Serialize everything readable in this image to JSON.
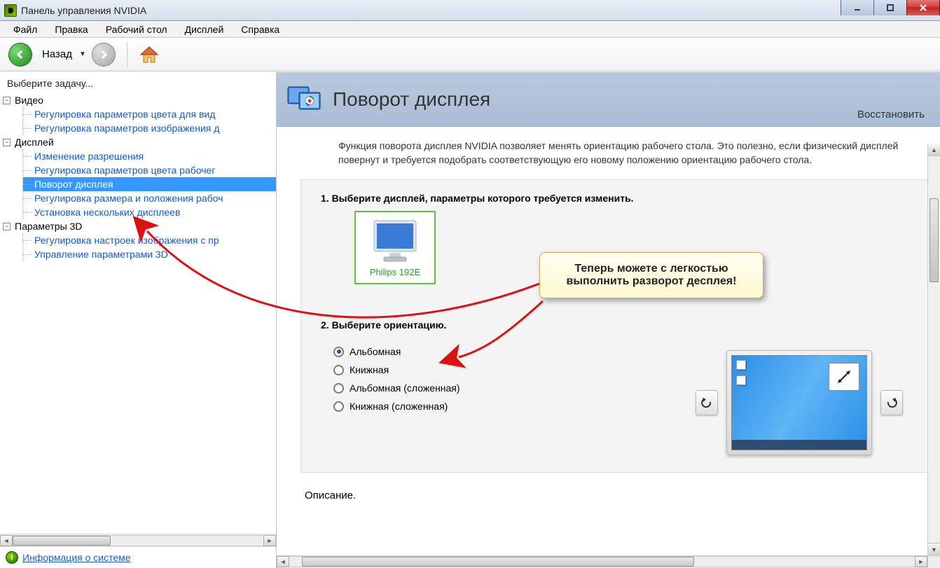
{
  "window": {
    "title": "Панель управления NVIDIA"
  },
  "menu": [
    "Файл",
    "Правка",
    "Рабочий стол",
    "Дисплей",
    "Справка"
  ],
  "toolbar": {
    "back": "Назад"
  },
  "sidebar": {
    "header": "Выберите задачу...",
    "groups": [
      {
        "label": "Видео",
        "items": [
          "Регулировка параметров цвета для вид",
          "Регулировка параметров изображения д"
        ]
      },
      {
        "label": "Дисплей",
        "items": [
          "Изменение разрешения",
          "Регулировка параметров цвета рабочег",
          "Поворот дисплея",
          "Регулировка размера и положения рабоч",
          "Установка нескольких дисплеев"
        ],
        "selected": 2
      },
      {
        "label": "Параметры 3D",
        "items": [
          "Регулировка настроек изображения с пр",
          "Управление параметрами 3D"
        ]
      }
    ],
    "sysinfo": "Информация о системе"
  },
  "page": {
    "title": "Поворот дисплея",
    "restore": "Восстановить",
    "description": "Функция поворота дисплея NVIDIA позволяет менять ориентацию рабочего стола. Это полезно, если физический дисплей повернут и требуется подобрать соответствующую его новому положению ориентацию рабочего стола.",
    "section1_title": "1. Выберите дисплей, параметры которого требуется изменить.",
    "display_name": "Philips 192E",
    "section2_title": "2. Выберите ориентацию.",
    "orientations": [
      "Альбомная",
      "Книжная",
      "Альбомная (сложенная)",
      "Книжная (сложенная)"
    ],
    "selected_orientation": 0,
    "desc_label": "Описание."
  },
  "callout": "Теперь можете с легкостью выполнить разворот десплея!"
}
